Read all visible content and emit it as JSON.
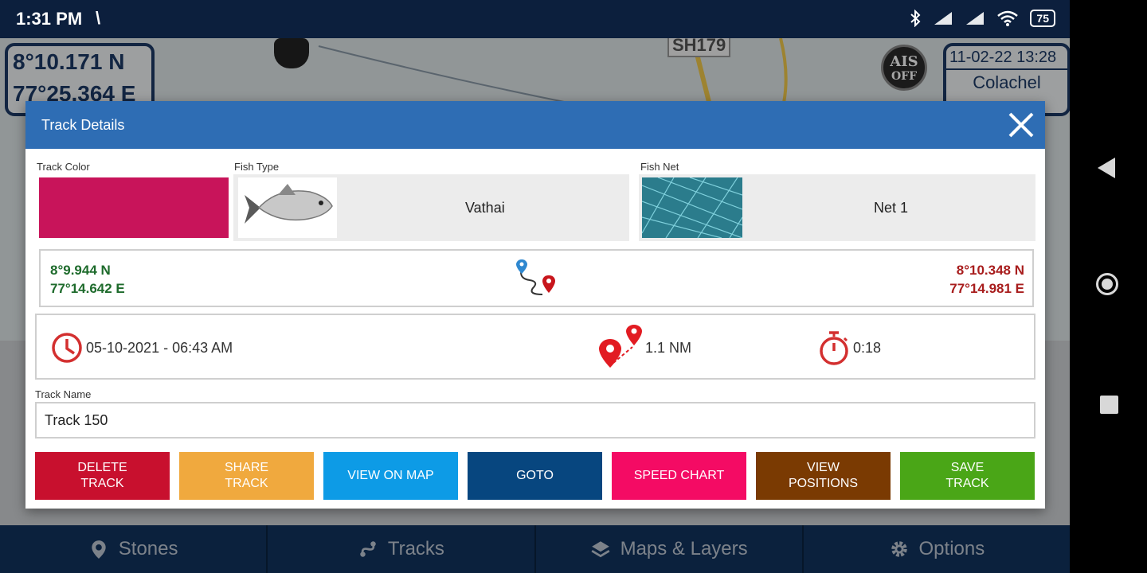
{
  "status_bar": {
    "time": "1:31 PM",
    "battery": "75"
  },
  "map": {
    "lat": "8°10.171 N",
    "lon": "77°25.364 E",
    "ais_line1": "AIS",
    "ais_line2": "OFF",
    "datetime": "11-02-22 13:28",
    "place": "Colachel",
    "road_label": "SH179"
  },
  "dialog": {
    "title": "Track Details",
    "track_color_label": "Track Color",
    "track_color": "#c8145a",
    "fish_type_label": "Fish Type",
    "fish_type": "Vathai",
    "fish_net_label": "Fish Net",
    "fish_net": "Net 1",
    "start_lat": "8°9.944 N",
    "start_lon": "77°14.642 E",
    "end_lat": "8°10.348 N",
    "end_lon": "77°14.981 E",
    "start_datetime": "05-10-2021 - 06:43 AM",
    "distance": "1.1 NM",
    "duration": "0:18",
    "track_name_label": "Track Name",
    "track_name": "Track 150",
    "buttons": [
      {
        "line1": "DELETE",
        "line2": "TRACK",
        "color": "#c8102e"
      },
      {
        "line1": "SHARE",
        "line2": "TRACK",
        "color": "#f0a93e"
      },
      {
        "line1": "VIEW ON MAP",
        "line2": "",
        "color": "#0d9be6"
      },
      {
        "line1": "GOTO",
        "line2": "",
        "color": "#07467f"
      },
      {
        "line1": "SPEED CHART",
        "line2": "",
        "color": "#f40b64"
      },
      {
        "line1": "VIEW",
        "line2": "POSITIONS",
        "color": "#7a3a02"
      },
      {
        "line1": "SAVE",
        "line2": "TRACK",
        "color": "#4aa617"
      }
    ]
  },
  "tabs": [
    {
      "label": "Stones",
      "icon": "location-pin-icon"
    },
    {
      "label": "Tracks",
      "icon": "route-icon"
    },
    {
      "label": "Maps & Layers",
      "icon": "layers-icon"
    },
    {
      "label": "Options",
      "icon": "gear-icon"
    }
  ]
}
